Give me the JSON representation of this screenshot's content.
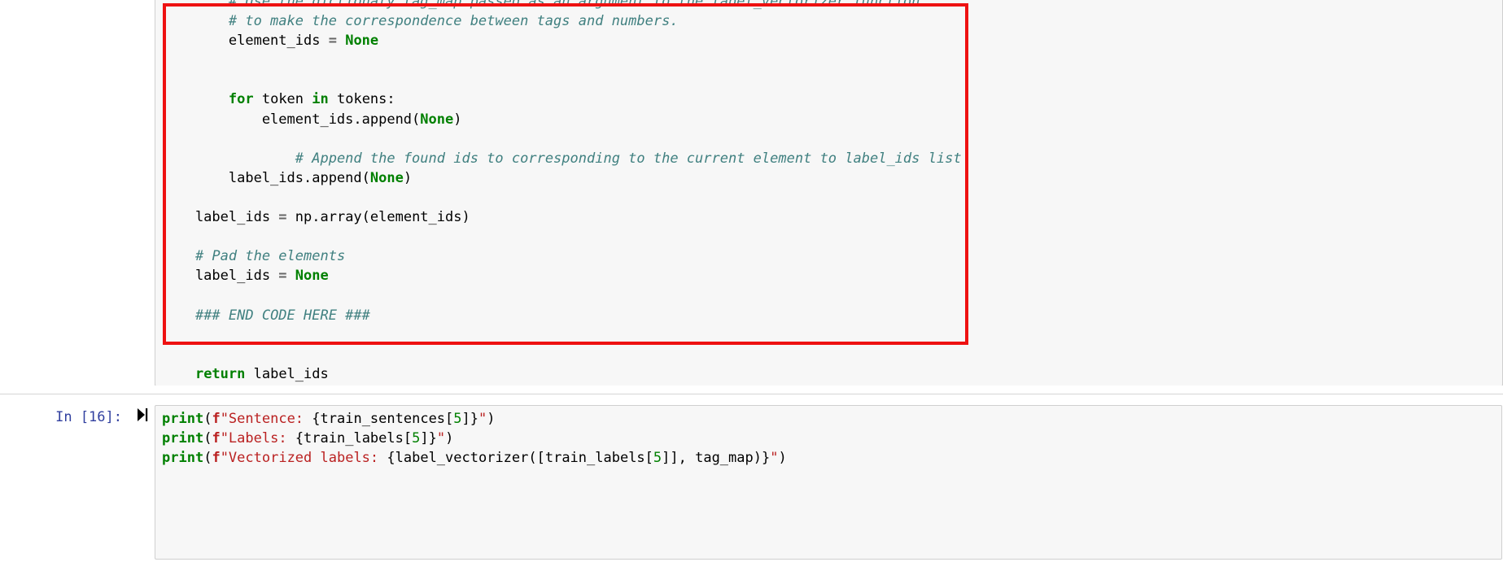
{
  "app": {
    "type": "jupyter-notebook"
  },
  "cells": [
    {
      "id": "code-cell-label-vectorizer",
      "prompt": "",
      "run_icon": "run-cell-icon",
      "highlight_color": "#ee1111",
      "code_lines": [
        "        # Use the dictionaty tag_map passed as an argument to the label_vectorizer function",
        "        # to make the correspondence between tags and numbers.",
        "        element_ids = None",
        "",
        "",
        "        for token in tokens:",
        "            element_ids.append(None)",
        "",
        "        # Append the found ids to corresponding to the current element to label_ids list",
        "        label_ids.append(None)",
        "",
        "    label_ids = np.array(element_ids)",
        "",
        "    # Pad the elements",
        "    label_ids = None",
        "",
        "    ### END CODE HERE ###",
        "",
        "",
        "    return label_ids"
      ]
    },
    {
      "id": "code-cell-print-demo",
      "prompt": "In [16]:",
      "run_icon": "run-cell-icon",
      "execution_count": "16",
      "code_lines": [
        "print(f\"Sentence: {train_sentences[5]}\")",
        "print(f\"Labels: {train_labels[5]}\")",
        "print(f\"Vectorized labels: {label_vectorizer([train_labels[5]], tag_map)}\")"
      ]
    }
  ],
  "colors": {
    "comment": "#408080",
    "keyword": "#008000",
    "builtin": "#008000",
    "string": "#BA2121",
    "operator": "#666666",
    "prompt": "#303F9F",
    "cell_background": "#f7f7f7",
    "annotation_red": "#ee1111",
    "selected_bar": "#42A5F5"
  }
}
